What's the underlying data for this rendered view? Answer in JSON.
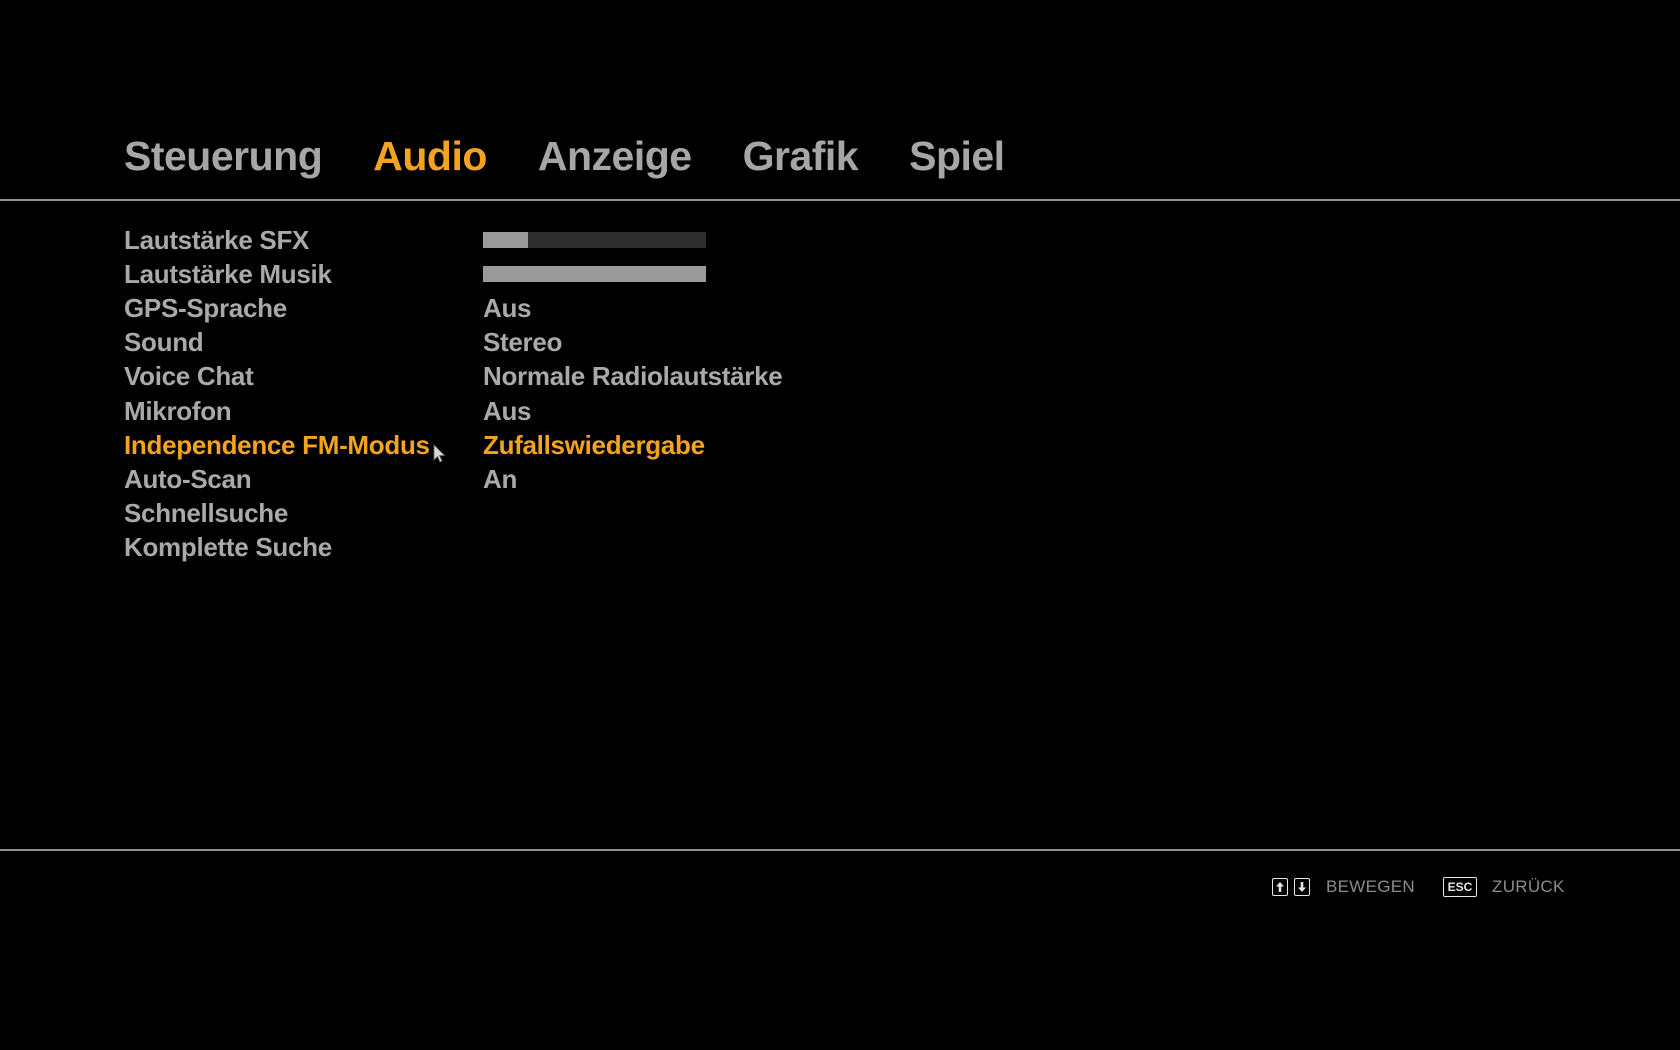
{
  "tabs": [
    {
      "label": "Steuerung",
      "active": false
    },
    {
      "label": "Audio",
      "active": true
    },
    {
      "label": "Anzeige",
      "active": false
    },
    {
      "label": "Grafik",
      "active": false
    },
    {
      "label": "Spiel",
      "active": false
    }
  ],
  "settings": [
    {
      "label": "Lautstärke SFX",
      "type": "slider",
      "level": 0.2
    },
    {
      "label": "Lautstärke Musik",
      "type": "slider",
      "level": 1.0
    },
    {
      "label": "GPS-Sprache",
      "value": "Aus"
    },
    {
      "label": "Sound",
      "value": "Stereo"
    },
    {
      "label": "Voice Chat",
      "value": "Normale Radiolautstärke"
    },
    {
      "label": "Mikrofon",
      "value": "Aus"
    },
    {
      "label": "Independence FM-Modus",
      "value": "Zufallswiedergabe",
      "selected": true
    },
    {
      "label": "Auto-Scan",
      "value": "An"
    },
    {
      "label": "Schnellsuche"
    },
    {
      "label": "Komplette Suche"
    }
  ],
  "hints": {
    "move_label": "BEWEGEN",
    "back_key": "ESC",
    "back_label": "ZURÜCK"
  },
  "colors": {
    "accent": "#f4a321",
    "text": "#a9a9a9",
    "background": "#000000"
  }
}
